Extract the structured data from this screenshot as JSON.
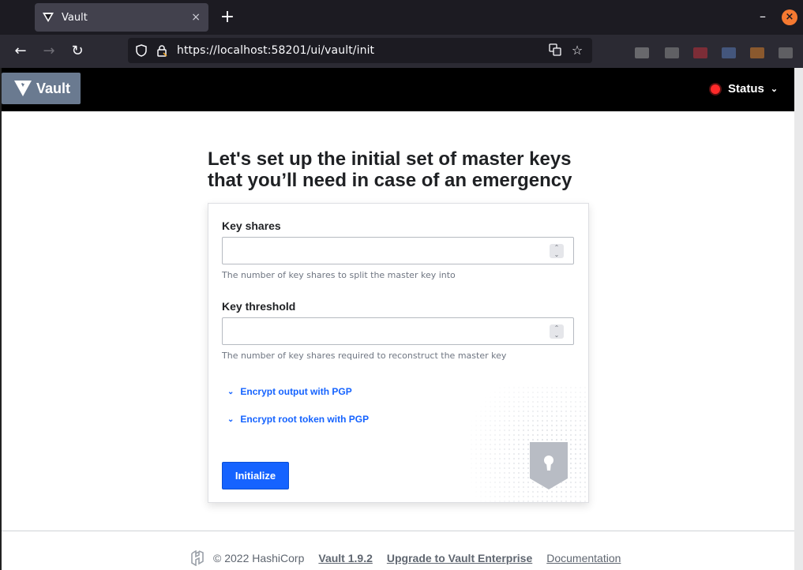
{
  "browser": {
    "tab_title": "Vault",
    "tab_close": "×",
    "new_tab": "+",
    "url": "https://localhost:58201/ui/vault/init",
    "minimize": "–",
    "close": "×"
  },
  "header": {
    "logo_text": "Vault",
    "status_label": "Status"
  },
  "main": {
    "heading_line1": "Let's set up the initial set of master keys",
    "heading_line2": "that you’ll need in case of an emergency",
    "key_shares": {
      "label": "Key shares",
      "value": "",
      "help": "The number of key shares to split the master key into"
    },
    "key_threshold": {
      "label": "Key threshold",
      "value": "",
      "help": "The number of key shares required to reconstruct the master key"
    },
    "toggles": [
      {
        "label": "Encrypt output with PGP"
      },
      {
        "label": "Encrypt root token with PGP"
      }
    ],
    "initialize_label": "Initialize"
  },
  "footer": {
    "copyright": "© 2022 HashiCorp",
    "version_link": "Vault 1.9.2",
    "upgrade_link": "Upgrade to Vault Enterprise",
    "docs_link": "Documentation"
  },
  "colors": {
    "accent": "#1563ff",
    "status_dot": "#ff2a2a"
  }
}
